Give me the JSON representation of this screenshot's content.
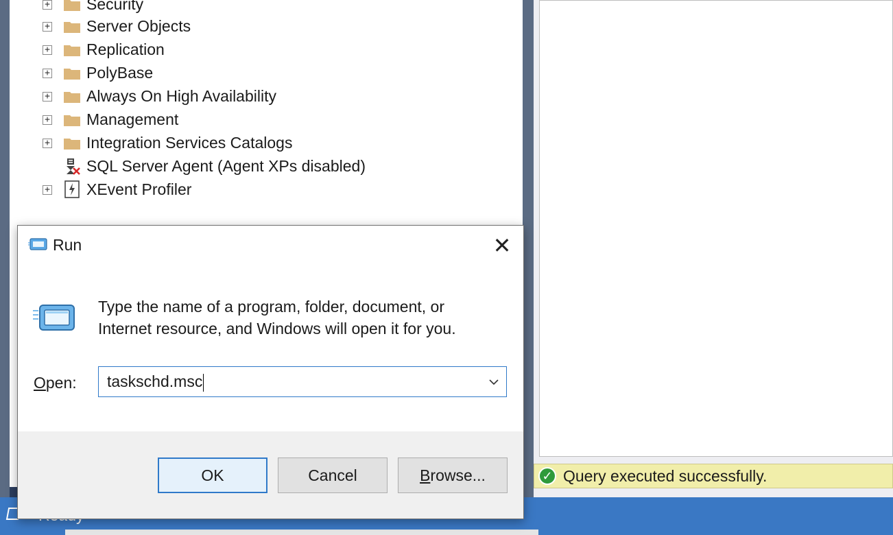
{
  "explorer": {
    "items": [
      {
        "label": "Security",
        "expandable": true,
        "icon": "folder-icon"
      },
      {
        "label": "Server Objects",
        "expandable": true,
        "icon": "folder-icon"
      },
      {
        "label": "Replication",
        "expandable": true,
        "icon": "folder-icon"
      },
      {
        "label": "PolyBase",
        "expandable": true,
        "icon": "folder-icon"
      },
      {
        "label": "Always On High Availability",
        "expandable": true,
        "icon": "folder-icon"
      },
      {
        "label": "Management",
        "expandable": true,
        "icon": "folder-icon"
      },
      {
        "label": "Integration Services Catalogs",
        "expandable": true,
        "icon": "folder-icon"
      },
      {
        "label": "SQL Server Agent (Agent XPs disabled)",
        "expandable": false,
        "icon": "sql-agent-disabled-icon"
      },
      {
        "label": "XEvent Profiler",
        "expandable": true,
        "icon": "xevent-profiler-icon"
      }
    ],
    "expand_glyph": "+"
  },
  "results": {
    "status_message": "Query executed successfully.",
    "status_icon": "check-circle-icon",
    "status_color": "#2f9a3b"
  },
  "statusbar": {
    "text": "Ready",
    "icon": "window-icon"
  },
  "run_dialog": {
    "title": "Run",
    "close_glyph": "✕",
    "description": "Type the name of a program, folder, document, or Internet resource, and Windows will open it for you.",
    "open_label_accel": "O",
    "open_label_rest": "pen:",
    "open_value": "taskschd.msc",
    "chevron_glyph": "⌵",
    "buttons": {
      "ok": "OK",
      "cancel": "Cancel",
      "browse_accel": "B",
      "browse_rest": "rowse..."
    }
  },
  "colors": {
    "accent": "#2f79c9",
    "statusbar": "#3a78c4",
    "folder": "#dcb67a",
    "status_highlight": "#f1eeaa"
  }
}
